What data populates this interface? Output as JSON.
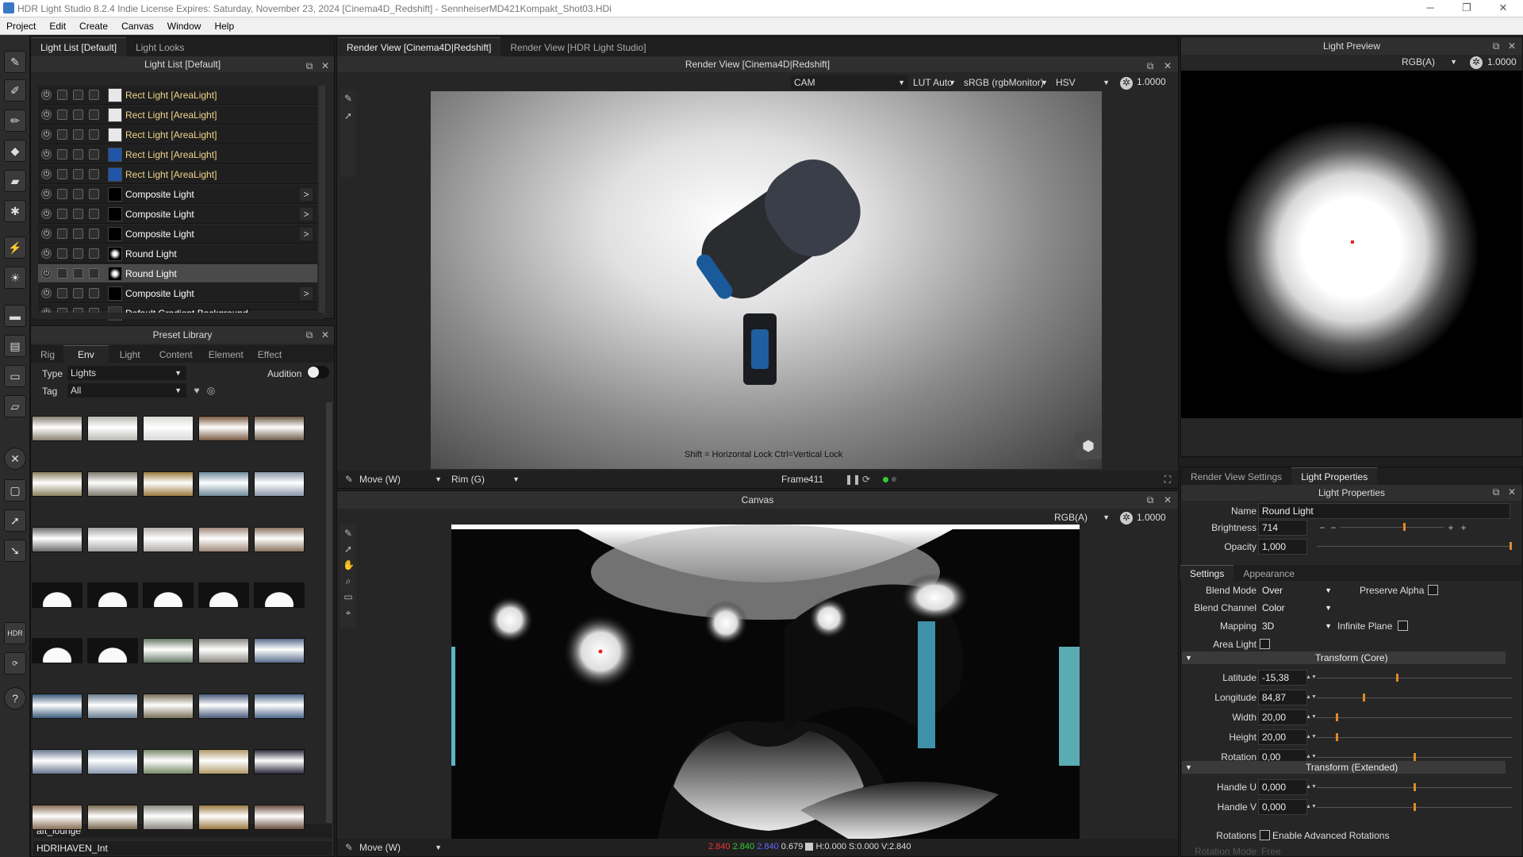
{
  "title": "HDR Light Studio 8.2.4  Indie License Expires: Saturday, November 23, 2024  [Cinema4D_Redshift] - SennheiserMD421Kompakt_Shot03.HDi",
  "window_controls": {
    "minimize": "─",
    "maximize": "❐",
    "close": "✕"
  },
  "menu": [
    "Project",
    "Edit",
    "Create",
    "Canvas",
    "Window",
    "Help"
  ],
  "light_list": {
    "tabs": [
      "Light List [Default]",
      "Light Looks"
    ],
    "header": "Light List [Default]",
    "items": [
      {
        "name": "Rect Light [AreaLight]",
        "type": "area",
        "thumb": "#e8e8e8",
        "arrow": ""
      },
      {
        "name": "Rect Light [AreaLight]",
        "type": "area",
        "thumb": "#e8e8e8",
        "arrow": ""
      },
      {
        "name": "Rect Light [AreaLight]",
        "type": "area",
        "thumb": "#e8e8e8",
        "arrow": ""
      },
      {
        "name": "Rect Light [AreaLight]",
        "type": "area",
        "thumb": "#1f56a8",
        "arrow": ""
      },
      {
        "name": "Rect Light [AreaLight]",
        "type": "area",
        "thumb": "#1f56a8",
        "arrow": ""
      },
      {
        "name": "Composite Light",
        "type": "normal",
        "thumb": "#000000",
        "arrow": ">"
      },
      {
        "name": "Composite Light",
        "type": "normal",
        "thumb": "#000000",
        "arrow": ">"
      },
      {
        "name": "Composite Light",
        "type": "normal",
        "thumb": "#000000",
        "arrow": ">"
      },
      {
        "name": "Round Light",
        "type": "normal",
        "thumb": "#000000",
        "arrow": ""
      },
      {
        "name": "Round Light",
        "type": "normal",
        "thumb": "#000000",
        "arrow": "",
        "selected": true
      },
      {
        "name": "Composite Light",
        "type": "normal",
        "thumb": "#000000",
        "arrow": ">"
      },
      {
        "name": "Default Gradient Background",
        "type": "normal",
        "thumb": "#333333",
        "arrow": ""
      }
    ]
  },
  "preset_library": {
    "header": "Preset Library",
    "tabs": [
      "Rig",
      "Env",
      "Light",
      "Content",
      "Element",
      "Effect"
    ],
    "type_label": "Type",
    "type_value": "Lights",
    "audition_label": "Audition",
    "tag_label": "Tag",
    "tag_value": "All",
    "thumb_colors": [
      "#8a8072",
      "#b9b8b2",
      "#d8d8d6",
      "#7a5a42",
      "#6d5a48",
      "#8a7f5e",
      "#7e7a6e",
      "#9a7a3e",
      "#6f8a9a",
      "#8a96a8",
      "#6b6b6b",
      "#a2a2a2",
      "#b0aea8",
      "#a0887a",
      "#8a7460",
      "#9a7a48",
      "#d8d8d8",
      "#d8d8d8",
      "#d8d8d8",
      "#d8d8d8",
      "#d0d0d0",
      "#d0d0d0",
      "#6a7a6a",
      "#8a8880",
      "#5a6e8a",
      "#3a5a7a",
      "#6a7e90",
      "#7a705a",
      "#4a5a7a",
      "#4e6a8a",
      "#6a7890",
      "#8a9ab0",
      "#7a8a6a",
      "#b09a6a",
      "#2a2a3a",
      "#8a7058",
      "#7a6a50",
      "#8a8880",
      "#9a7a40",
      "#6a5040"
    ],
    "names": [
      "aft_lounge",
      "HDRIHAVEN_Int"
    ]
  },
  "render_view": {
    "tabs": [
      "Render View [Cinema4D|Redshift]",
      "Render View [HDR Light Studio]"
    ],
    "header": "Render View [Cinema4D|Redshift]",
    "camera": "CAM",
    "lut": "LUT Auto",
    "colorspace": "sRGB (rgbMonitor)",
    "mode": "HSV",
    "exposure": "1.0000",
    "hint": "Shift = Horizontal Lock   Ctrl=Vertical Lock",
    "tool": "Move (W)",
    "rim": "Rim (G)",
    "frame_label": "Frame",
    "frame_value": "411"
  },
  "canvas": {
    "header": "Canvas",
    "channel": "RGB(A)",
    "exposure": "1.0000",
    "tool": "Move (W)",
    "readout_r": "2.840",
    "readout_g": "2.840",
    "readout_b": "2.840",
    "readout_a": "0.679",
    "readout_hsv": "H:0.000 S:0.000 V:2.840"
  },
  "light_preview": {
    "header": "Light Preview",
    "channel": "RGB(A)",
    "exposure": "1.0000"
  },
  "properties": {
    "tabs": [
      "Render View Settings",
      "Light Properties"
    ],
    "header": "Light Properties",
    "name_label": "Name",
    "name_value": "Round Light",
    "brightness_label": "Brightness",
    "brightness_value": "714",
    "brightness_level": 0.62,
    "opacity_label": "Opacity",
    "opacity_value": "1,000",
    "opacity_level": 1.0,
    "subtabs": [
      "Settings",
      "Appearance"
    ],
    "blend_mode_label": "Blend Mode",
    "blend_mode_value": "Over",
    "preserve_alpha_label": "Preserve Alpha",
    "blend_channel_label": "Blend Channel",
    "blend_channel_value": "Color",
    "mapping_label": "Mapping",
    "mapping_value": "3D",
    "infinite_plane_label": "Infinite Plane",
    "area_light_label": "Area Light",
    "transform_core": "Transform (Core)",
    "latitude_label": "Latitude",
    "latitude_value": "-15,38",
    "latitude_level": 0.41,
    "longitude_label": "Longitude",
    "longitude_value": "84,87",
    "longitude_level": 0.24,
    "width_label": "Width",
    "width_value": "20,00",
    "width_level": 0.1,
    "height_label": "Height",
    "height_value": "20,00",
    "height_level": 0.1,
    "rotation_label": "Rotation",
    "rotation_value": "0,00",
    "rotation_level": 0.5,
    "transform_ext": "Transform (Extended)",
    "handle_u_label": "Handle U",
    "handle_u_value": "0,000",
    "handle_u_level": 0.5,
    "handle_v_label": "Handle V",
    "handle_v_value": "0,000",
    "handle_v_level": 0.5,
    "rotations_label": "Rotations",
    "enable_adv_label": "Enable Advanced Rotations",
    "rotation_mode_label": "Rotation Mode",
    "rotation_mode_value": "Free"
  }
}
